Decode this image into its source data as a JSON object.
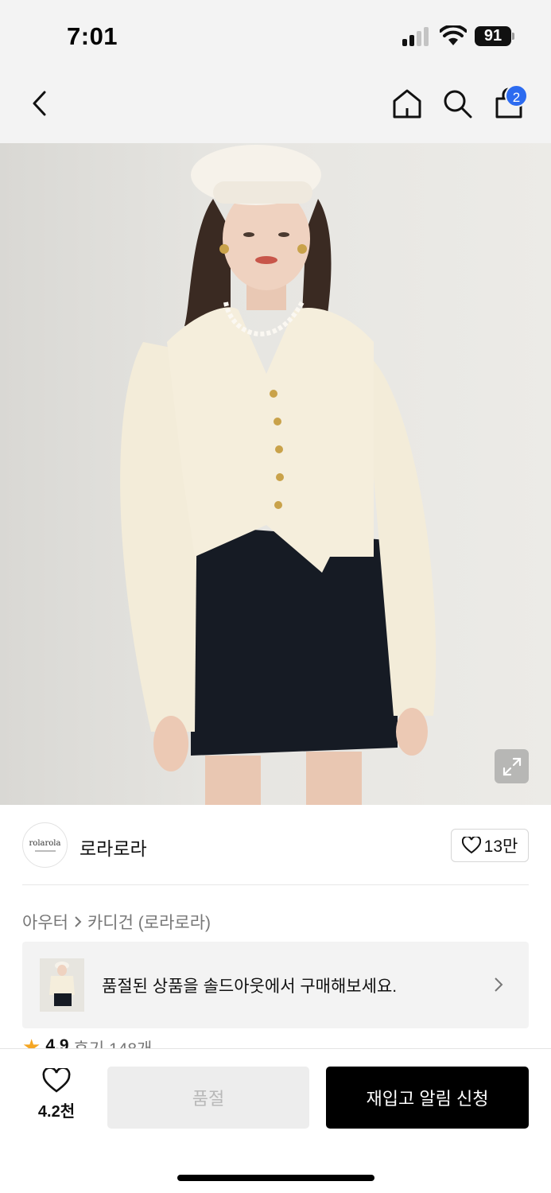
{
  "status_bar": {
    "time": "7:01",
    "battery": "91"
  },
  "nav": {
    "back_icon": "chevron-left-icon",
    "home_icon": "home-icon",
    "search_icon": "search-icon",
    "bag_icon": "shopping-bag-icon",
    "cart_badge": "2",
    "badge_color": "#2c6bf0"
  },
  "hero": {
    "expand_icon": "expand-icon"
  },
  "brand": {
    "logo_text": "rolarola",
    "name": "로라로라",
    "likes": "13만"
  },
  "breadcrumb": {
    "category": "아우터",
    "subcategory": "카디건 (로라로라)"
  },
  "soldout_card": {
    "text": "품절된 상품을 솔드아웃에서 구매해보세요."
  },
  "rating": {
    "value": "4.9",
    "reviews": "후기 148개"
  },
  "bottom": {
    "wish_count": "4.2천",
    "soldout_label": "품절",
    "restock_label": "재입고 알림 신청"
  }
}
